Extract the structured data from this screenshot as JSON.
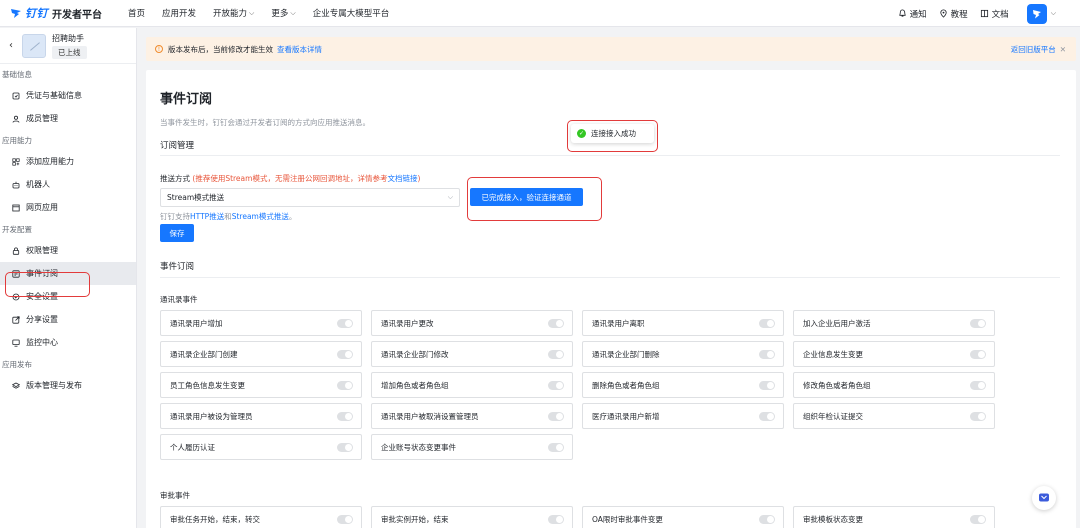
{
  "brand": {
    "name": "钉钉",
    "title": "开发者平台"
  },
  "nav": [
    {
      "label": "首页",
      "has_dropdown": false
    },
    {
      "label": "应用开发",
      "has_dropdown": false
    },
    {
      "label": "开放能力",
      "has_dropdown": true
    },
    {
      "label": "更多",
      "has_dropdown": true
    },
    {
      "label": "企业专属大模型平台",
      "has_dropdown": false
    }
  ],
  "top_right": {
    "notify": "通知",
    "tutorial": "教程",
    "docs": "文档"
  },
  "app": {
    "name": "招聘助手",
    "status": "已上线"
  },
  "sidebar": {
    "groups": [
      {
        "title": "基础信息",
        "items": [
          {
            "label": "凭证与基础信息",
            "icon": "credential-icon"
          },
          {
            "label": "成员管理",
            "icon": "person-icon"
          }
        ]
      },
      {
        "title": "应用能力",
        "items": [
          {
            "label": "添加应用能力",
            "icon": "add-grid-icon"
          },
          {
            "label": "机器人",
            "icon": "robot-icon"
          },
          {
            "label": "网页应用",
            "icon": "webpage-icon"
          }
        ]
      },
      {
        "title": "开发配置",
        "items": [
          {
            "label": "权限管理",
            "icon": "lock-icon"
          },
          {
            "label": "事件订阅",
            "icon": "event-icon",
            "active": true
          },
          {
            "label": "安全设置",
            "icon": "shield-icon"
          },
          {
            "label": "分享设置",
            "icon": "share-icon"
          },
          {
            "label": "监控中心",
            "icon": "monitor-icon"
          }
        ]
      },
      {
        "title": "应用发布",
        "items": [
          {
            "label": "版本管理与发布",
            "icon": "layers-icon"
          }
        ]
      }
    ]
  },
  "notice": {
    "text": "版本发布后，当前修改才能生效",
    "link": "查看版本详情",
    "old_version": "返回旧版平台"
  },
  "page": {
    "title": "事件订阅",
    "desc": "当事件发生时，钉钉会通过开发者订阅的方式向应用推送消息。",
    "sub_section": "订阅管理",
    "push_label": "推送方式",
    "push_hint": "(推荐使用Stream模式，无需注册公网回调地址，详情参考",
    "push_doc_link": "文档链接",
    "push_hint_end": ")",
    "select_value": "Stream模式推送",
    "support_prefix": "钉钉支持",
    "support_http": "HTTP推送",
    "support_and": "和",
    "support_stream": "Stream模式推送",
    "support_suffix": "。",
    "save": "保存",
    "verify": "已完成接入，验证连接通道",
    "toast": "连接接入成功",
    "events_section": "事件订阅",
    "contacts_group": "通讯录事件",
    "approval_group": "审批事件"
  },
  "contacts_events": [
    "通讯录用户增加",
    "通讯录用户更改",
    "通讯录用户离职",
    "加入企业后用户激活",
    "通讯录企业部门创建",
    "通讯录企业部门修改",
    "通讯录企业部门删除",
    "企业信息发生变更",
    "员工角色信息发生变更",
    "增加角色或者角色组",
    "删除角色或者角色组",
    "修改角色或者角色组",
    "通讯录用户被设为管理员",
    "通讯录用户被取消设置管理员",
    "医疗通讯录用户新增",
    "组织年检认证提交",
    "个人履历认证",
    "企业账号状态变更事件"
  ],
  "approval_events": [
    "审批任务开始，结束，转交",
    "审批实例开始，结束",
    "OA限时审批事件变更",
    "审批模板状态变更"
  ]
}
